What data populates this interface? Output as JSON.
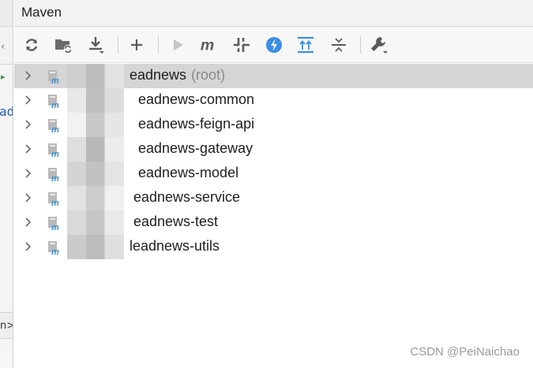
{
  "panel": {
    "title": "Maven"
  },
  "left_strip": {
    "code_fragment": "ad",
    "breadcrumb_fragment": "n>"
  },
  "toolbar": {
    "buttons": [
      {
        "icon": "reload-icon",
        "label": "Reload All Maven Projects"
      },
      {
        "icon": "generate-sources-icon",
        "label": "Generate Sources and Update Folders"
      },
      {
        "icon": "download-icon",
        "label": "Download Sources and/or Documentation"
      },
      {
        "icon": "plus-icon",
        "label": "Add Maven Projects"
      },
      {
        "icon": "run-icon",
        "label": "Run Maven Build"
      },
      {
        "icon": "maven-goal-icon",
        "label": "Execute Maven Goal"
      },
      {
        "icon": "toggle-offline-icon",
        "label": "Toggle Offline Mode"
      },
      {
        "icon": "skip-tests-icon",
        "label": "Toggle 'Skip Tests' Mode"
      },
      {
        "icon": "show-dependencies-icon",
        "label": "Show Dependencies"
      },
      {
        "icon": "collapse-all-icon",
        "label": "Collapse All"
      },
      {
        "icon": "settings-wrench-icon",
        "label": "Maven Settings"
      }
    ]
  },
  "tree": {
    "items": [
      {
        "label": "eadnews",
        "suffix": "(root)",
        "selected": true
      },
      {
        "label": "eadnews-common",
        "suffix": "",
        "selected": false
      },
      {
        "label": "eadnews-feign-api",
        "suffix": "",
        "selected": false
      },
      {
        "label": "eadnews-gateway",
        "suffix": "",
        "selected": false
      },
      {
        "label": "eadnews-model",
        "suffix": "",
        "selected": false
      },
      {
        "label": "eadnews-service",
        "suffix": "",
        "selected": false
      },
      {
        "label": "eadnews-test",
        "suffix": "",
        "selected": false
      },
      {
        "label": "leadnews-utils",
        "suffix": "",
        "selected": false
      }
    ]
  },
  "watermark": "CSDN @PeiNaichao",
  "colors": {
    "selection": "#d5d5d5",
    "maven_icon_blue": "#3e8fd6",
    "skip_tests_blue": "#3a8ee6",
    "toolbar_bg": "#f7f7f7",
    "header_bg": "#f2f2f2"
  }
}
